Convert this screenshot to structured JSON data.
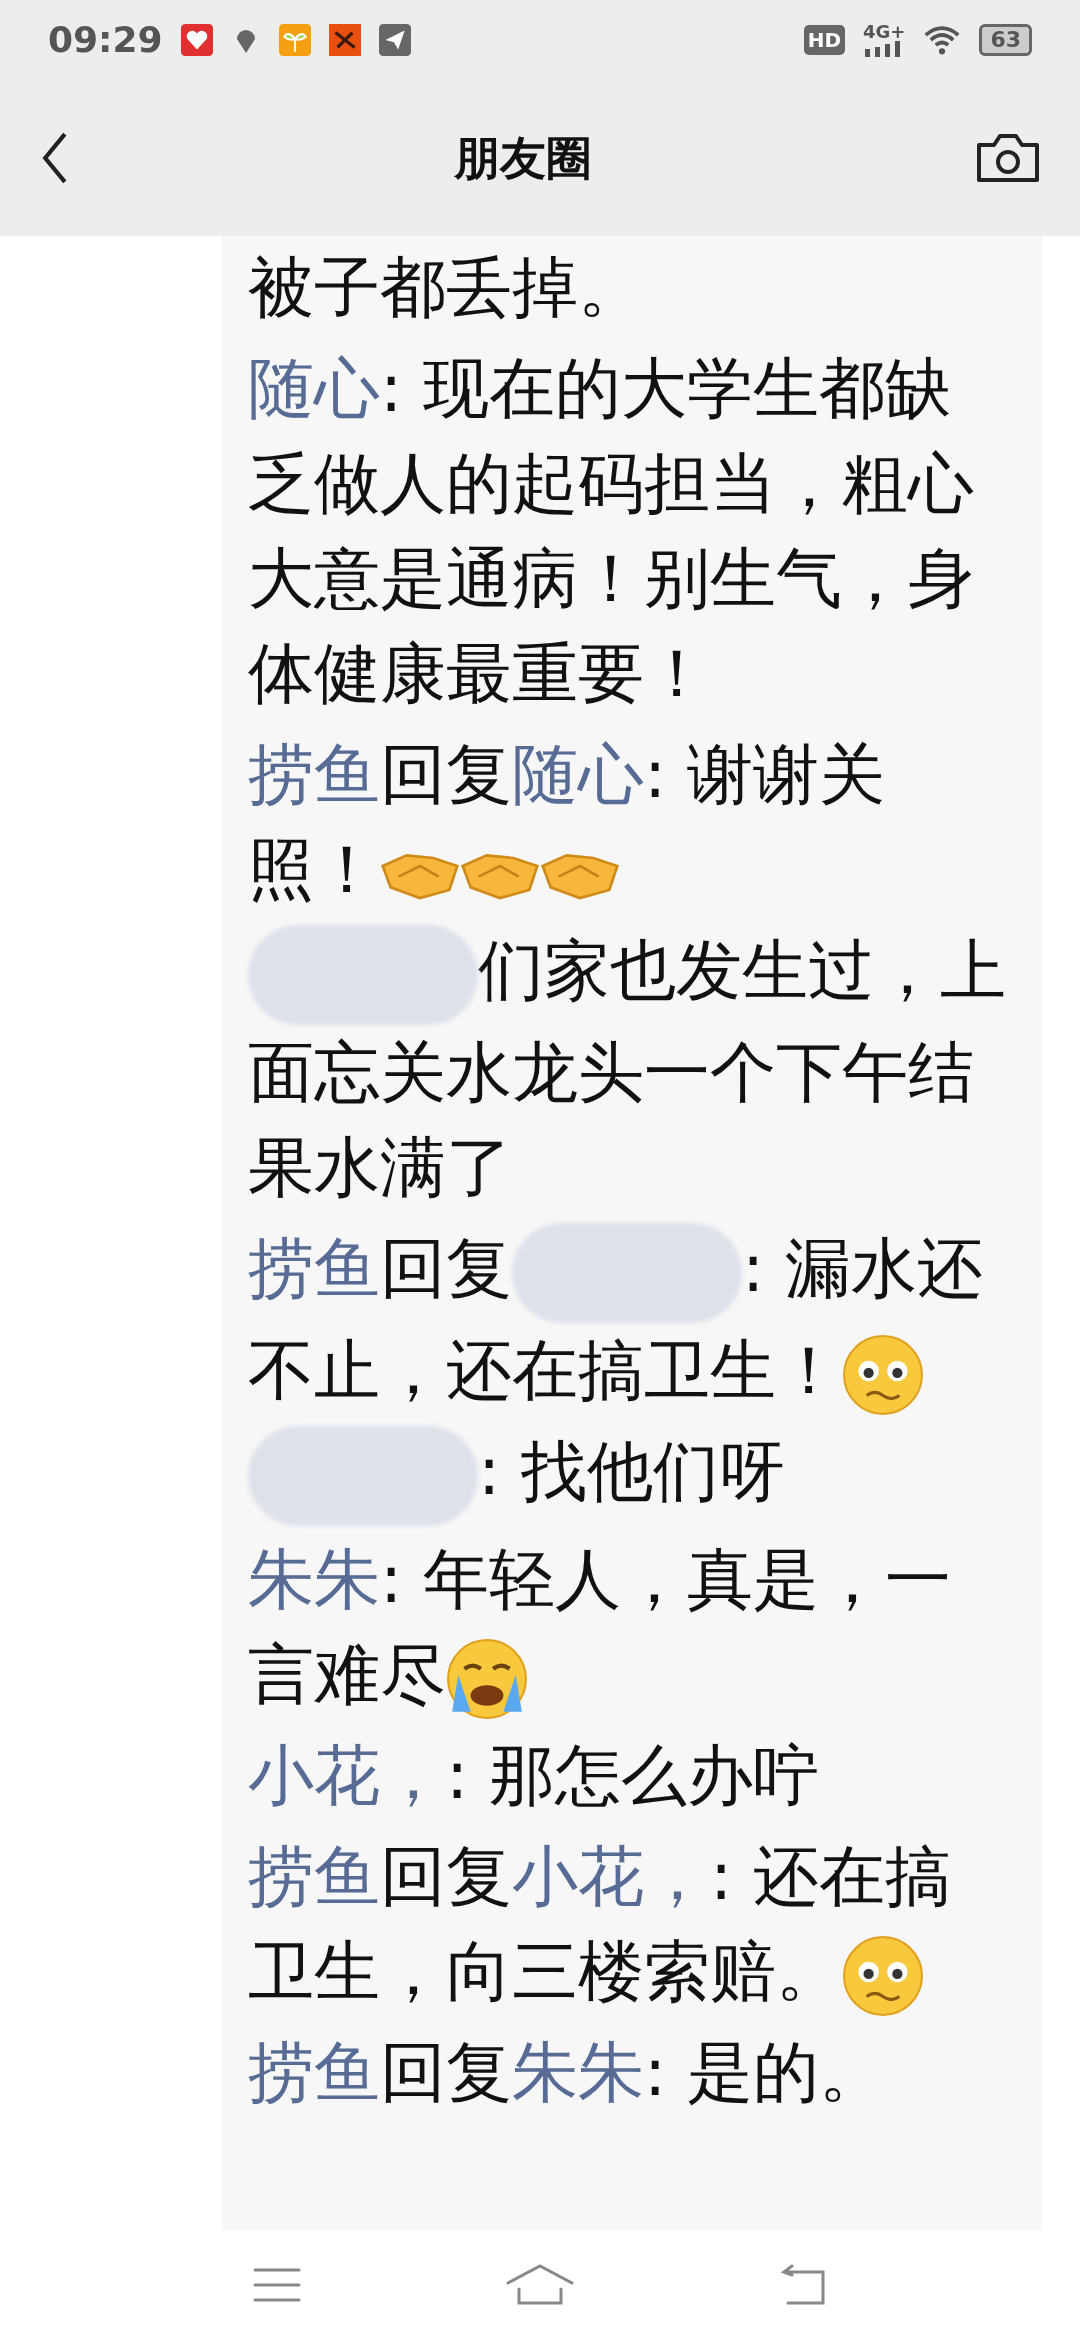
{
  "status_bar": {
    "time": "09:29",
    "hd": "HD",
    "network": "4G+",
    "battery": "63"
  },
  "header": {
    "title": "朋友圈"
  },
  "comments": [
    {
      "parts": [
        {
          "kind": "text",
          "text": "被子都丢掉。"
        }
      ]
    },
    {
      "parts": [
        {
          "kind": "name",
          "text": "随心"
        },
        {
          "kind": "text",
          "text": ": 现在的大学生都缺乏做人的起码担当，粗心大意是通病！别生气，身体健康最重要！"
        }
      ]
    },
    {
      "parts": [
        {
          "kind": "name",
          "text": "捞鱼"
        },
        {
          "kind": "text",
          "text": "回复"
        },
        {
          "kind": "name",
          "text": "随心"
        },
        {
          "kind": "text",
          "text": ": 谢谢关照！"
        },
        {
          "kind": "handshake"
        },
        {
          "kind": "handshake"
        },
        {
          "kind": "handshake"
        }
      ]
    },
    {
      "parts": [
        {
          "kind": "blur"
        },
        {
          "kind": "text",
          "text": "们家也发生过，上面忘关水龙头一个下午结果水满了"
        }
      ]
    },
    {
      "parts": [
        {
          "kind": "name",
          "text": "捞鱼"
        },
        {
          "kind": "text",
          "text": "回复"
        },
        {
          "kind": "blur"
        },
        {
          "kind": "text",
          "text": ": 漏水还不止，还在搞卫生！"
        },
        {
          "kind": "worried"
        }
      ]
    },
    {
      "parts": [
        {
          "kind": "blur"
        },
        {
          "kind": "text",
          "text": ": 找他们呀"
        }
      ]
    },
    {
      "parts": [
        {
          "kind": "name",
          "text": "朱朱"
        },
        {
          "kind": "text",
          "text": ": 年轻人，真是，一言难尽"
        },
        {
          "kind": "crying"
        }
      ]
    },
    {
      "parts": [
        {
          "kind": "name",
          "text": "小花，"
        },
        {
          "kind": "text",
          "text": ": 那怎么办咛"
        }
      ]
    },
    {
      "parts": [
        {
          "kind": "name",
          "text": "捞鱼"
        },
        {
          "kind": "text",
          "text": "回复"
        },
        {
          "kind": "name",
          "text": "小花，"
        },
        {
          "kind": "text",
          "text": ": 还在搞卫生，向三楼索赔。"
        },
        {
          "kind": "worried"
        }
      ]
    },
    {
      "parts": [
        {
          "kind": "name",
          "text": "捞鱼"
        },
        {
          "kind": "text",
          "text": "回复"
        },
        {
          "kind": "name",
          "text": "朱朱"
        },
        {
          "kind": "text",
          "text": ": 是的。"
        }
      ]
    }
  ]
}
